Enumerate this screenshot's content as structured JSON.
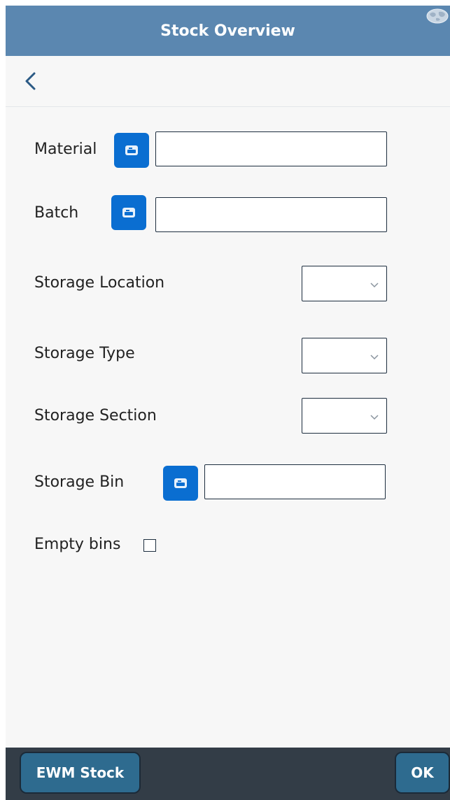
{
  "header": {
    "title": "Stock Overview",
    "globe_icon": "globe-icon",
    "color": "#5b87b0"
  },
  "nav": {
    "back_icon": "chevron-left-icon"
  },
  "form": {
    "material": {
      "label": "Material",
      "value": "",
      "scan_icon": "barcode-scan-icon"
    },
    "batch": {
      "label": "Batch",
      "value": "",
      "scan_icon": "barcode-scan-icon"
    },
    "storage_location": {
      "label": "Storage Location",
      "selected": "",
      "icon": "chevron-down-icon"
    },
    "storage_type": {
      "label": "Storage Type",
      "selected": "",
      "icon": "chevron-down-icon"
    },
    "storage_section": {
      "label": "Storage Section",
      "selected": "",
      "icon": "chevron-down-icon"
    },
    "storage_bin": {
      "label": "Storage Bin",
      "value": "",
      "scan_icon": "barcode-scan-icon"
    },
    "empty_bins": {
      "label": "Empty bins",
      "checked": false
    }
  },
  "footer": {
    "ewm_stock_label": "EWM Stock",
    "ok_label": "OK",
    "button_color": "#2e6b8f",
    "bar_color": "#333d47"
  },
  "colors": {
    "accent": "#0a6ed1",
    "border": "#1d2d3e"
  }
}
